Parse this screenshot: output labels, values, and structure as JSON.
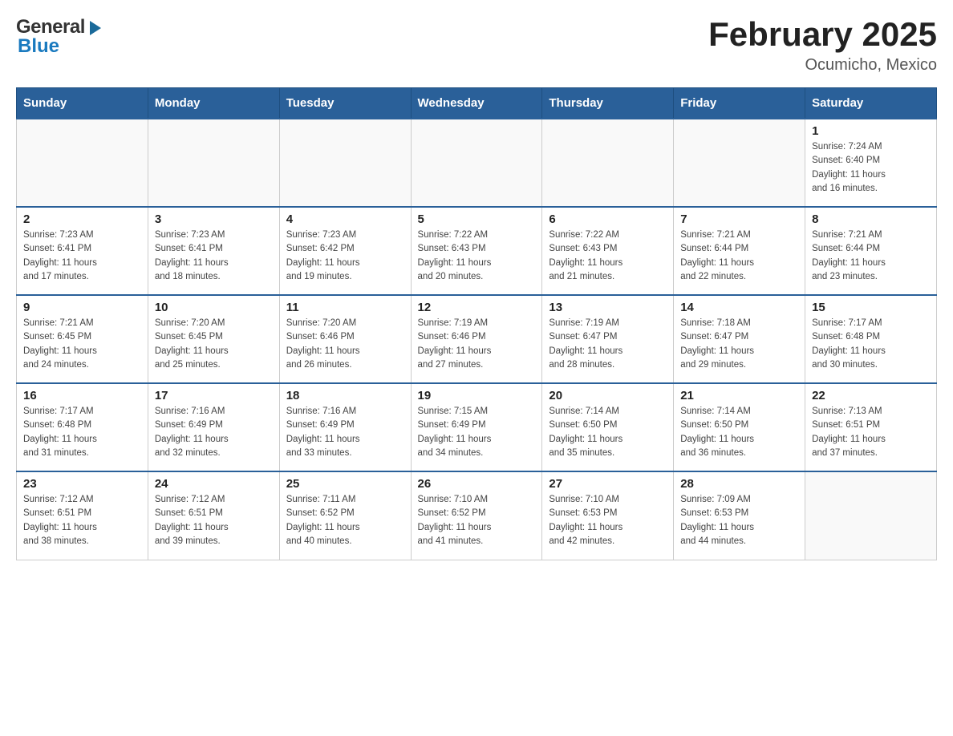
{
  "header": {
    "logo": {
      "general": "General",
      "blue": "Blue",
      "arrow": "▶"
    },
    "title": "February 2025",
    "location": "Ocumicho, Mexico"
  },
  "calendar": {
    "days_of_week": [
      "Sunday",
      "Monday",
      "Tuesday",
      "Wednesday",
      "Thursday",
      "Friday",
      "Saturday"
    ],
    "weeks": [
      {
        "days": [
          {
            "number": "",
            "info": ""
          },
          {
            "number": "",
            "info": ""
          },
          {
            "number": "",
            "info": ""
          },
          {
            "number": "",
            "info": ""
          },
          {
            "number": "",
            "info": ""
          },
          {
            "number": "",
            "info": ""
          },
          {
            "number": "1",
            "info": "Sunrise: 7:24 AM\nSunset: 6:40 PM\nDaylight: 11 hours\nand 16 minutes."
          }
        ]
      },
      {
        "days": [
          {
            "number": "2",
            "info": "Sunrise: 7:23 AM\nSunset: 6:41 PM\nDaylight: 11 hours\nand 17 minutes."
          },
          {
            "number": "3",
            "info": "Sunrise: 7:23 AM\nSunset: 6:41 PM\nDaylight: 11 hours\nand 18 minutes."
          },
          {
            "number": "4",
            "info": "Sunrise: 7:23 AM\nSunset: 6:42 PM\nDaylight: 11 hours\nand 19 minutes."
          },
          {
            "number": "5",
            "info": "Sunrise: 7:22 AM\nSunset: 6:43 PM\nDaylight: 11 hours\nand 20 minutes."
          },
          {
            "number": "6",
            "info": "Sunrise: 7:22 AM\nSunset: 6:43 PM\nDaylight: 11 hours\nand 21 minutes."
          },
          {
            "number": "7",
            "info": "Sunrise: 7:21 AM\nSunset: 6:44 PM\nDaylight: 11 hours\nand 22 minutes."
          },
          {
            "number": "8",
            "info": "Sunrise: 7:21 AM\nSunset: 6:44 PM\nDaylight: 11 hours\nand 23 minutes."
          }
        ]
      },
      {
        "days": [
          {
            "number": "9",
            "info": "Sunrise: 7:21 AM\nSunset: 6:45 PM\nDaylight: 11 hours\nand 24 minutes."
          },
          {
            "number": "10",
            "info": "Sunrise: 7:20 AM\nSunset: 6:45 PM\nDaylight: 11 hours\nand 25 minutes."
          },
          {
            "number": "11",
            "info": "Sunrise: 7:20 AM\nSunset: 6:46 PM\nDaylight: 11 hours\nand 26 minutes."
          },
          {
            "number": "12",
            "info": "Sunrise: 7:19 AM\nSunset: 6:46 PM\nDaylight: 11 hours\nand 27 minutes."
          },
          {
            "number": "13",
            "info": "Sunrise: 7:19 AM\nSunset: 6:47 PM\nDaylight: 11 hours\nand 28 minutes."
          },
          {
            "number": "14",
            "info": "Sunrise: 7:18 AM\nSunset: 6:47 PM\nDaylight: 11 hours\nand 29 minutes."
          },
          {
            "number": "15",
            "info": "Sunrise: 7:17 AM\nSunset: 6:48 PM\nDaylight: 11 hours\nand 30 minutes."
          }
        ]
      },
      {
        "days": [
          {
            "number": "16",
            "info": "Sunrise: 7:17 AM\nSunset: 6:48 PM\nDaylight: 11 hours\nand 31 minutes."
          },
          {
            "number": "17",
            "info": "Sunrise: 7:16 AM\nSunset: 6:49 PM\nDaylight: 11 hours\nand 32 minutes."
          },
          {
            "number": "18",
            "info": "Sunrise: 7:16 AM\nSunset: 6:49 PM\nDaylight: 11 hours\nand 33 minutes."
          },
          {
            "number": "19",
            "info": "Sunrise: 7:15 AM\nSunset: 6:49 PM\nDaylight: 11 hours\nand 34 minutes."
          },
          {
            "number": "20",
            "info": "Sunrise: 7:14 AM\nSunset: 6:50 PM\nDaylight: 11 hours\nand 35 minutes."
          },
          {
            "number": "21",
            "info": "Sunrise: 7:14 AM\nSunset: 6:50 PM\nDaylight: 11 hours\nand 36 minutes."
          },
          {
            "number": "22",
            "info": "Sunrise: 7:13 AM\nSunset: 6:51 PM\nDaylight: 11 hours\nand 37 minutes."
          }
        ]
      },
      {
        "days": [
          {
            "number": "23",
            "info": "Sunrise: 7:12 AM\nSunset: 6:51 PM\nDaylight: 11 hours\nand 38 minutes."
          },
          {
            "number": "24",
            "info": "Sunrise: 7:12 AM\nSunset: 6:51 PM\nDaylight: 11 hours\nand 39 minutes."
          },
          {
            "number": "25",
            "info": "Sunrise: 7:11 AM\nSunset: 6:52 PM\nDaylight: 11 hours\nand 40 minutes."
          },
          {
            "number": "26",
            "info": "Sunrise: 7:10 AM\nSunset: 6:52 PM\nDaylight: 11 hours\nand 41 minutes."
          },
          {
            "number": "27",
            "info": "Sunrise: 7:10 AM\nSunset: 6:53 PM\nDaylight: 11 hours\nand 42 minutes."
          },
          {
            "number": "28",
            "info": "Sunrise: 7:09 AM\nSunset: 6:53 PM\nDaylight: 11 hours\nand 44 minutes."
          },
          {
            "number": "",
            "info": ""
          }
        ]
      }
    ]
  }
}
